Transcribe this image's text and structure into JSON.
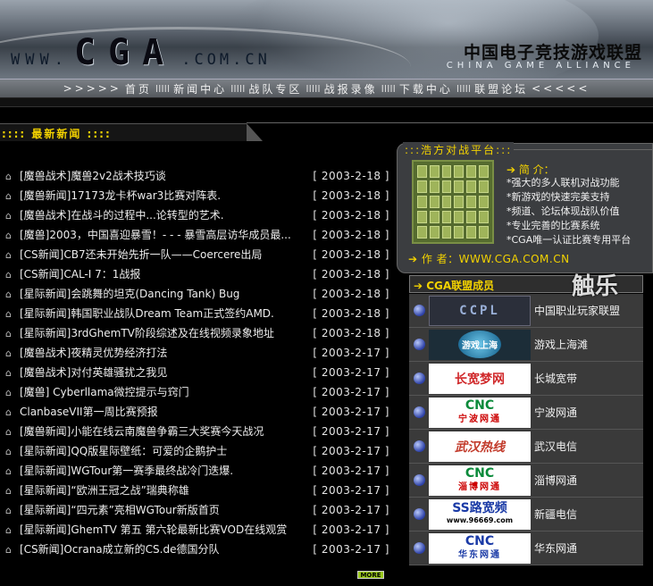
{
  "banner": {
    "www": "WWW.",
    "logo": "CGA",
    "domain": ".COM.CN",
    "brand_cn": "中国电子竞技游戏联盟",
    "brand_en": "CHINA GAME ALLIANCE"
  },
  "nav": {
    "lead": ">>>>>",
    "trail": "<<<<<",
    "separator": "IIIII",
    "items": [
      "首页",
      "新闻中心",
      "战队专区",
      "战报录像",
      "下载中心",
      "联盟论坛"
    ]
  },
  "news": {
    "heading": ":::: 最新新闻 ::::",
    "more_label": "MORE",
    "items": [
      {
        "title": "[魔兽战术]魔兽2v2战术技巧谈",
        "date": "[ 2003-2-18 ]"
      },
      {
        "title": "[魔兽新闻]17173龙卡杯war3比赛对阵表.",
        "date": "[ 2003-2-18 ]"
      },
      {
        "title": "[魔兽战术]在战斗的过程中...论转型的艺术.",
        "date": "[ 2003-2-18 ]"
      },
      {
        "title": "[魔兽]2003，中国喜迎暴雪！- - - 暴雪高层访华成员最...",
        "date": "[ 2003-2-18 ]"
      },
      {
        "title": "[CS新闻]CB7还未开始先折一队——Coercere出局",
        "date": "[ 2003-2-18 ]"
      },
      {
        "title": "[CS新闻]CAL-I 7：1战报",
        "date": "[ 2003-2-18 ]"
      },
      {
        "title": "[星际新闻]会跳舞的坦克(Dancing Tank) Bug",
        "date": "[ 2003-2-18 ]"
      },
      {
        "title": "[星际新闻]韩国职业战队Dream Team正式签约AMD.",
        "date": "[ 2003-2-18 ]"
      },
      {
        "title": "[星际新闻]3rdGhemTV阶段综述及在线视频录象地址",
        "date": "[ 2003-2-18 ]"
      },
      {
        "title": "[魔兽战术]夜精灵优势经济打法",
        "date": "[ 2003-2-17 ]"
      },
      {
        "title": "[魔兽战术]对付英雄骚扰之我见",
        "date": "[ 2003-2-17 ]"
      },
      {
        "title": "[魔兽] Cyberllama微控提示与窍门",
        "date": "[ 2003-2-17 ]"
      },
      {
        "title": "ClanbaseVII第一周比赛预报",
        "date": "[ 2003-2-17 ]"
      },
      {
        "title": "[魔兽新闻]小能在线云南魔兽争霸三大奖赛今天战况",
        "date": "[ 2003-2-17 ]"
      },
      {
        "title": "[星际新闻]QQ版星际壁纸：可爱的企鹅护士",
        "date": "[ 2003-2-17 ]"
      },
      {
        "title": "[星际新闻]WGTour第一赛季最终战冷门迭爆.",
        "date": "[ 2003-2-17 ]"
      },
      {
        "title": "[星际新闻]“欧洲王冠之战”瑞典称雄",
        "date": "[ 2003-2-17 ]"
      },
      {
        "title": "[星际新闻]“四元素”亮相WGTour新版首页",
        "date": "[ 2003-2-17 ]"
      },
      {
        "title": "[星际新闻]GhemTV 第五 第六轮最新比赛VOD在线观赏",
        "date": "[ 2003-2-17 ]"
      },
      {
        "title": "[CS新闻]Ocrana成立新的CS.de德国分队",
        "date": "[ 2003-2-17 ]"
      }
    ]
  },
  "platform": {
    "heading": ":::浩方对战平台:::",
    "intro_heading": "➔ 简 介：",
    "features": [
      "*强大的多人联机对战功能",
      "*新游戏的快速完美支持",
      "*频道、论坛体现战队价值",
      "*专业完善的比赛系统",
      "*CGA唯一认证比赛专用平台"
    ],
    "author": "➔ 作 者：WWW.CGA.COM.CN"
  },
  "members": {
    "heading": "➔ CGA联盟成员",
    "items": [
      {
        "logo": "CCPL",
        "name": "中国职业玩家联盟"
      },
      {
        "logo": "游戏上海",
        "name": "游戏上海滩"
      },
      {
        "logo": "长宽梦网",
        "name": "长城宽带"
      },
      {
        "logo": "CNC",
        "logo_sub": "宁波网通",
        "name": "宁波网通"
      },
      {
        "logo": "武汉热线",
        "name": "武汉电信"
      },
      {
        "logo": "CNC",
        "logo_sub": "淄博网通",
        "name": "淄博网通"
      },
      {
        "logo": "SS路宽频",
        "logo_sub": "www.96669.com",
        "name": "新疆电信"
      },
      {
        "logo": "CNC",
        "logo_sub": "华东网通",
        "name": "华东网通"
      }
    ]
  },
  "watermark": "触乐"
}
